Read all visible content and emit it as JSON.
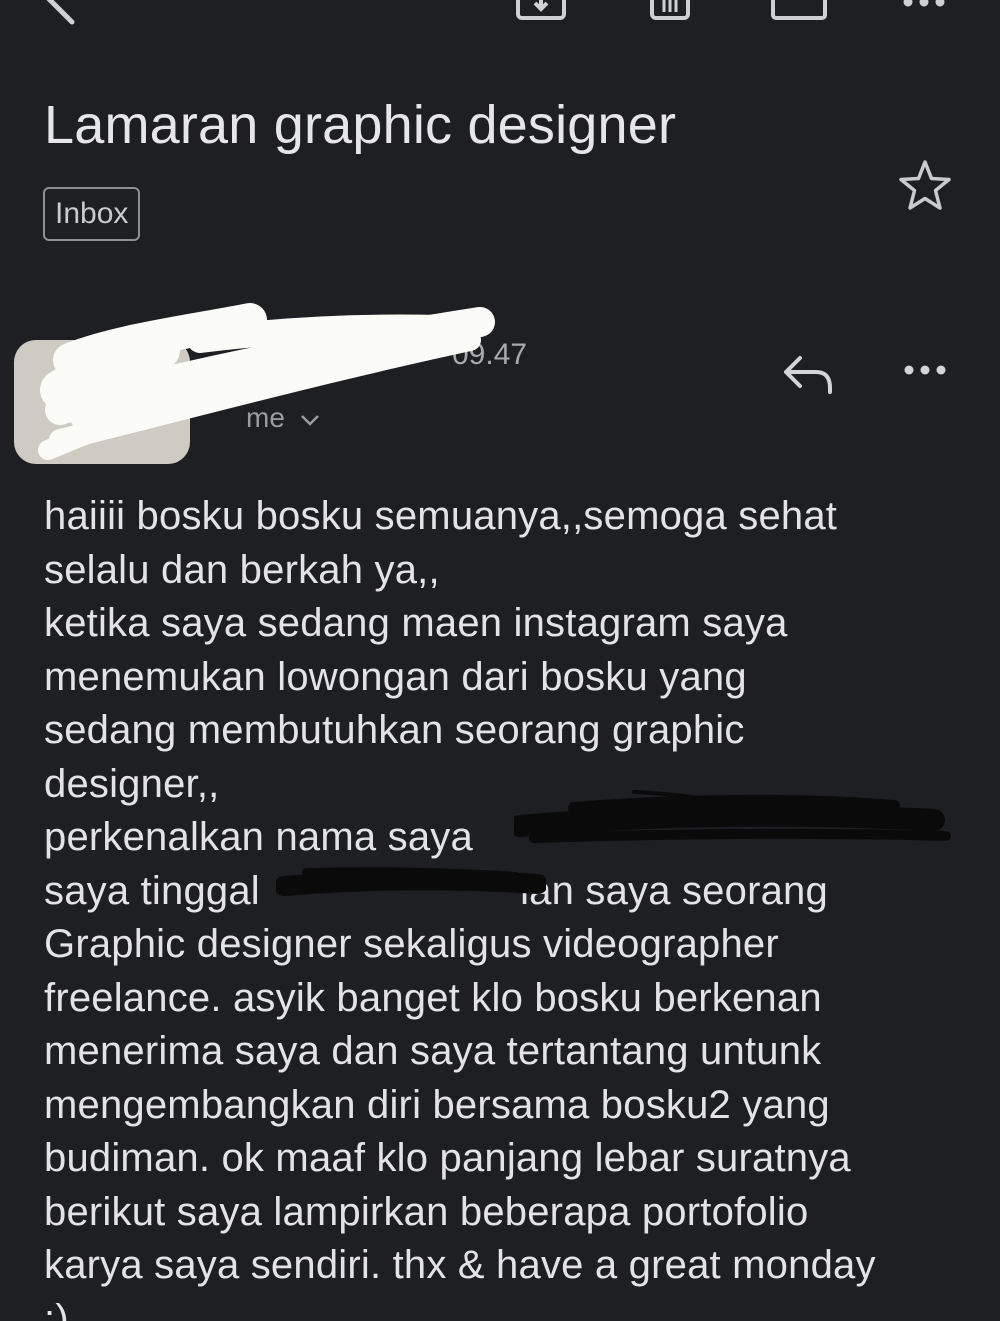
{
  "email": {
    "subject": "Lamaran graphic designer",
    "label": "Inbox",
    "sender": {
      "name": "",
      "time": "09.47",
      "recipient": "me"
    },
    "body_lines": [
      "haiiii bosku bosku semuanya,,semoga sehat",
      "selalu dan berkah ya,,",
      "ketika saya sedang maen instagram saya",
      "menemukan lowongan dari bosku yang",
      "sedang membutuhkan seorang graphic",
      "designer,,",
      "perkenalkan nama saya",
      "saya tinggal                       ian saya seorang",
      "Graphic designer sekaligus videographer",
      "freelance. asyik banget klo bosku berkenan",
      "menerima saya dan saya tertantang untunk",
      "mengembangkan diri bersama bosku2 yang",
      "budiman. ok maaf klo panjang lebar suratnya",
      "berikut saya lampirkan beberapa portofolio",
      "karya saya sendiri. thx & have a great monday",
      ":)"
    ]
  },
  "icons": {
    "back": "back-arrow-icon",
    "archive": "archive-icon",
    "delete": "trash-icon",
    "mark_unread": "mail-icon",
    "overflow": "more-horizontal-icon",
    "star": "star-icon",
    "reply": "reply-icon",
    "more": "more-horizontal-icon"
  },
  "colors": {
    "background": "#1e1f22",
    "text": "#e3e3e5",
    "secondary_text": "#a8a9ad",
    "label_border": "#8d8f93"
  }
}
